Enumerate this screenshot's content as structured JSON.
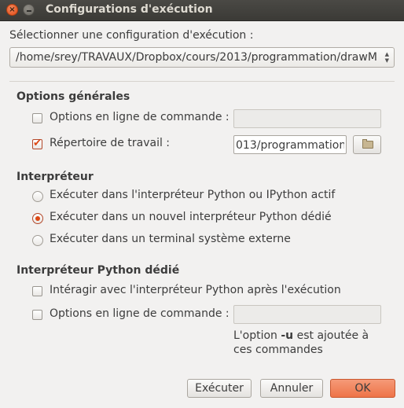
{
  "window": {
    "title": "Configurations d'exécution",
    "close_glyph": "×"
  },
  "select_label": "Sélectionner une configuration d'exécution :",
  "config_combo": {
    "value": "/home/srey/TRAVAUX/Dropbox/cours/2013/programmation/drawM",
    "arrows": "▲▼"
  },
  "general": {
    "title": "Options générales",
    "cmdline_label": "Options en ligne de commande :",
    "cmdline_checked": false,
    "cmdline_value": "",
    "workdir_label": "Répertoire de travail :",
    "workdir_checked": true,
    "workdir_value": "013/programmation"
  },
  "interpreter": {
    "title": "Interpréteur",
    "options": [
      {
        "label": "Exécuter dans l'interpréteur Python ou IPython actif",
        "selected": false
      },
      {
        "label": "Exécuter dans un nouvel interpréteur Python dédié",
        "selected": true
      },
      {
        "label": "Exécuter dans un terminal système externe",
        "selected": false
      }
    ]
  },
  "dedicated": {
    "title": "Interpréteur Python dédié",
    "interact_label": "Intéragir avec l'interpréteur Python après l'exécution",
    "interact_checked": false,
    "cmdline_label": "Options en ligne de commande :",
    "cmdline_checked": false,
    "cmdline_value": "",
    "note_prefix": "L'option ",
    "note_flag": "-u",
    "note_suffix": " est ajoutée à",
    "note_line2": "ces commandes"
  },
  "buttons": {
    "execute": "Exécuter",
    "cancel": "Annuler",
    "ok": "OK"
  },
  "colors": {
    "accent": "#dd4814",
    "ok_button": "#ee7448",
    "titlebar": "#3b3a36",
    "background": "#f2f1f0"
  }
}
